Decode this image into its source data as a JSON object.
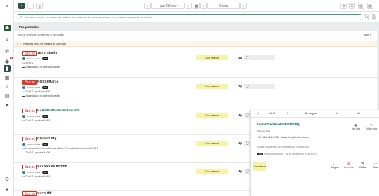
{
  "sidebar": {
    "badge": "2"
  },
  "topbar": {
    "date": "jue 13 nov",
    "today_icon": "calendar-icon",
    "filter": "Cena",
    "guest_count": "99"
  },
  "search": {
    "placeholder": "Busca un nombre, un número de teléfono, una dirección de correo electrónico o un número de mesa en el servicio"
  },
  "section": {
    "title": "Programadas"
  },
  "panel": {
    "totals": "Total de reservas: 0 reservas (0 personas)",
    "more": "More",
    "warning": "reservas fuera del horario de apertura"
  },
  "reservations": [
    {
      "time": "19:00",
      "name": "TEST Shalini",
      "tag": "Primera visita",
      "vip": "VIP",
      "line1": "30,00 €",
      "line2": "Garantizado con tarjeta de crédito",
      "status": "Con reserva",
      "pax": "3p"
    },
    {
      "time": "19:30",
      "name": "ROSSI Marco",
      "tag": "Primera visita",
      "vip": "VIP",
      "line1": "20,00 € · propina 0,00 €",
      "line2": "Garantizado con tarjeta de crédito",
      "status": "Con reserva",
      "pax": "2p"
    },
    {
      "time": "14:00",
      "name": "KAHHNNNNNNNN faisal00",
      "tag": "Primera visita",
      "vip": "VIP",
      "line1": "70,00 € · propina 0,00 €",
      "line2": "",
      "status": "Con reserva",
      "pax": "4p"
    },
    {
      "time": "14:30",
      "name": "GGGGG Ffg",
      "tag": "Primera visita",
      "vip": "VIP",
      "line1": "La carta di riferimento Cosesa Milano / Formula business lunch 22,00 €",
      "line2": "70,00 € · propina 0,00 €",
      "status": "Con reserva",
      "pax": "4p"
    },
    {
      "time": "14:30",
      "name": "XXXXXXXX ffffffffff",
      "tag": "Primera visita",
      "vip": "VIP",
      "line1": "70,00 € · propina 0,00 €",
      "line2": "",
      "status": "Con reserva",
      "pax": "4p"
    },
    {
      "time": "15:00",
      "name": "YYYY ffff",
      "tag": "",
      "vip": "",
      "line1": "",
      "line2": "",
      "status": "",
      "pax": ""
    }
  ],
  "detail": {
    "time": "14:00",
    "assign": "Sin asignar",
    "pax": "4p",
    "name": "faisal00 KAHHNNNNNNNN",
    "sub": "Primera visita",
    "view_info": "Ver info",
    "edit_info": "Editar info",
    "phone": "+39 363 024 1435 · faisal.test@thefork.com",
    "note": "Esta es interna. Sin información confidencial",
    "payment": "Pago confirmado · 13 de noviembre a las 10:57",
    "status": "Con reserva",
    "assign_btn": "Asignar",
    "cancel_btn": "Cancelar",
    "edit_btn": "Editar",
    "more_btn": "Más"
  }
}
